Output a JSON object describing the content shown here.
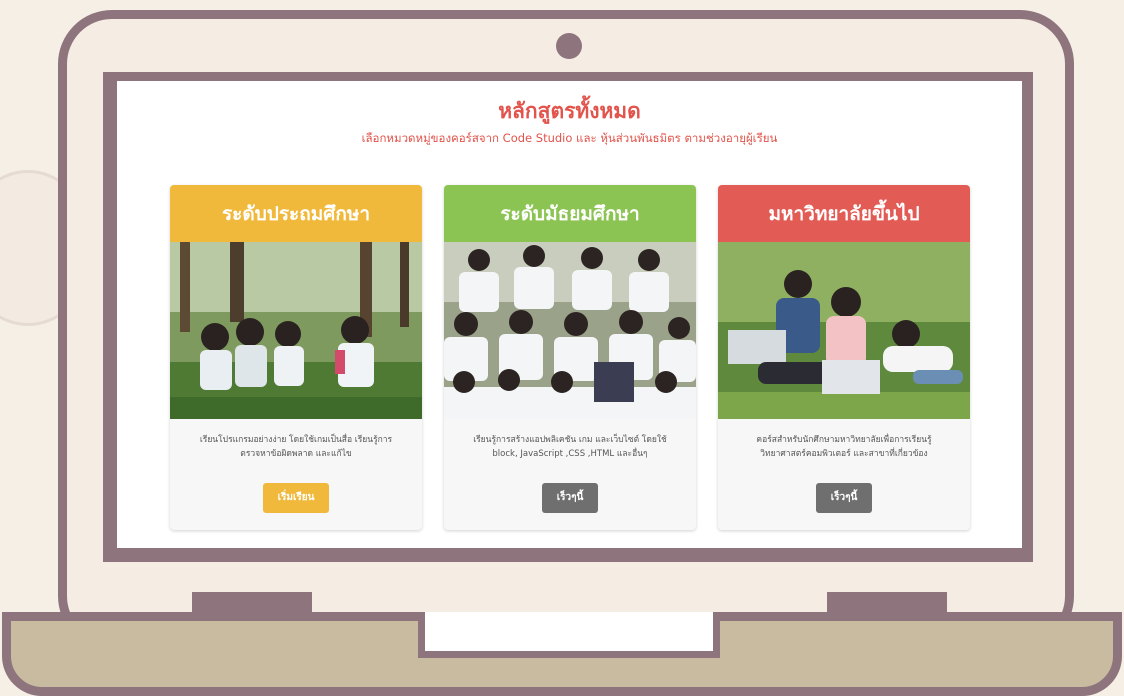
{
  "page": {
    "title": "หลักสูตรทั้งหมด",
    "subtitle": "เลือกหมวดหมู่ของคอร์สจาก Code Studio และ หุ้นส่วนพันธมิตร ตามช่วงอายุผู้เรียน"
  },
  "cards": [
    {
      "heading": "ระดับประถมศึกษา",
      "description": "เรียนโปรแกรมอย่างง่าย โดยใช้เกมเป็นสื่อ เรียนรู้การตรวจหาข้อผิดพลาด และแก้ไข",
      "button_label": "เริ่มเรียน",
      "header_color": "#f0b93b",
      "button_color": "#f0b93b"
    },
    {
      "heading": "ระดับมัธยมศึกษา",
      "description": "เรียนรู้การสร้างแอปพลิเคชัน เกม และเว็บไซต์ โดยใช้ block, JavaScript ,CSS ,HTML และอื่นๆ",
      "button_label": "เร็วๆนี้",
      "header_color": "#8cc454",
      "button_color": "#6f6f6f"
    },
    {
      "heading": "มหาวิทยาลัยขึ้นไป",
      "description": "คอร์สสำหรับนักศึกษามหาวิทยาลัยเพื่อการเรียนรู้ วิทยาศาสตร์คอมพิวเตอร์ และสาขาที่เกี่ยวข้อง",
      "button_label": "เร็วๆนี้",
      "header_color": "#e25c55",
      "button_color": "#6f6f6f"
    }
  ],
  "colors": {
    "laptop_frame": "#8e747d",
    "laptop_base": "#c8bb9f",
    "background": "#f6efe6",
    "title_accent": "#e2534b"
  }
}
